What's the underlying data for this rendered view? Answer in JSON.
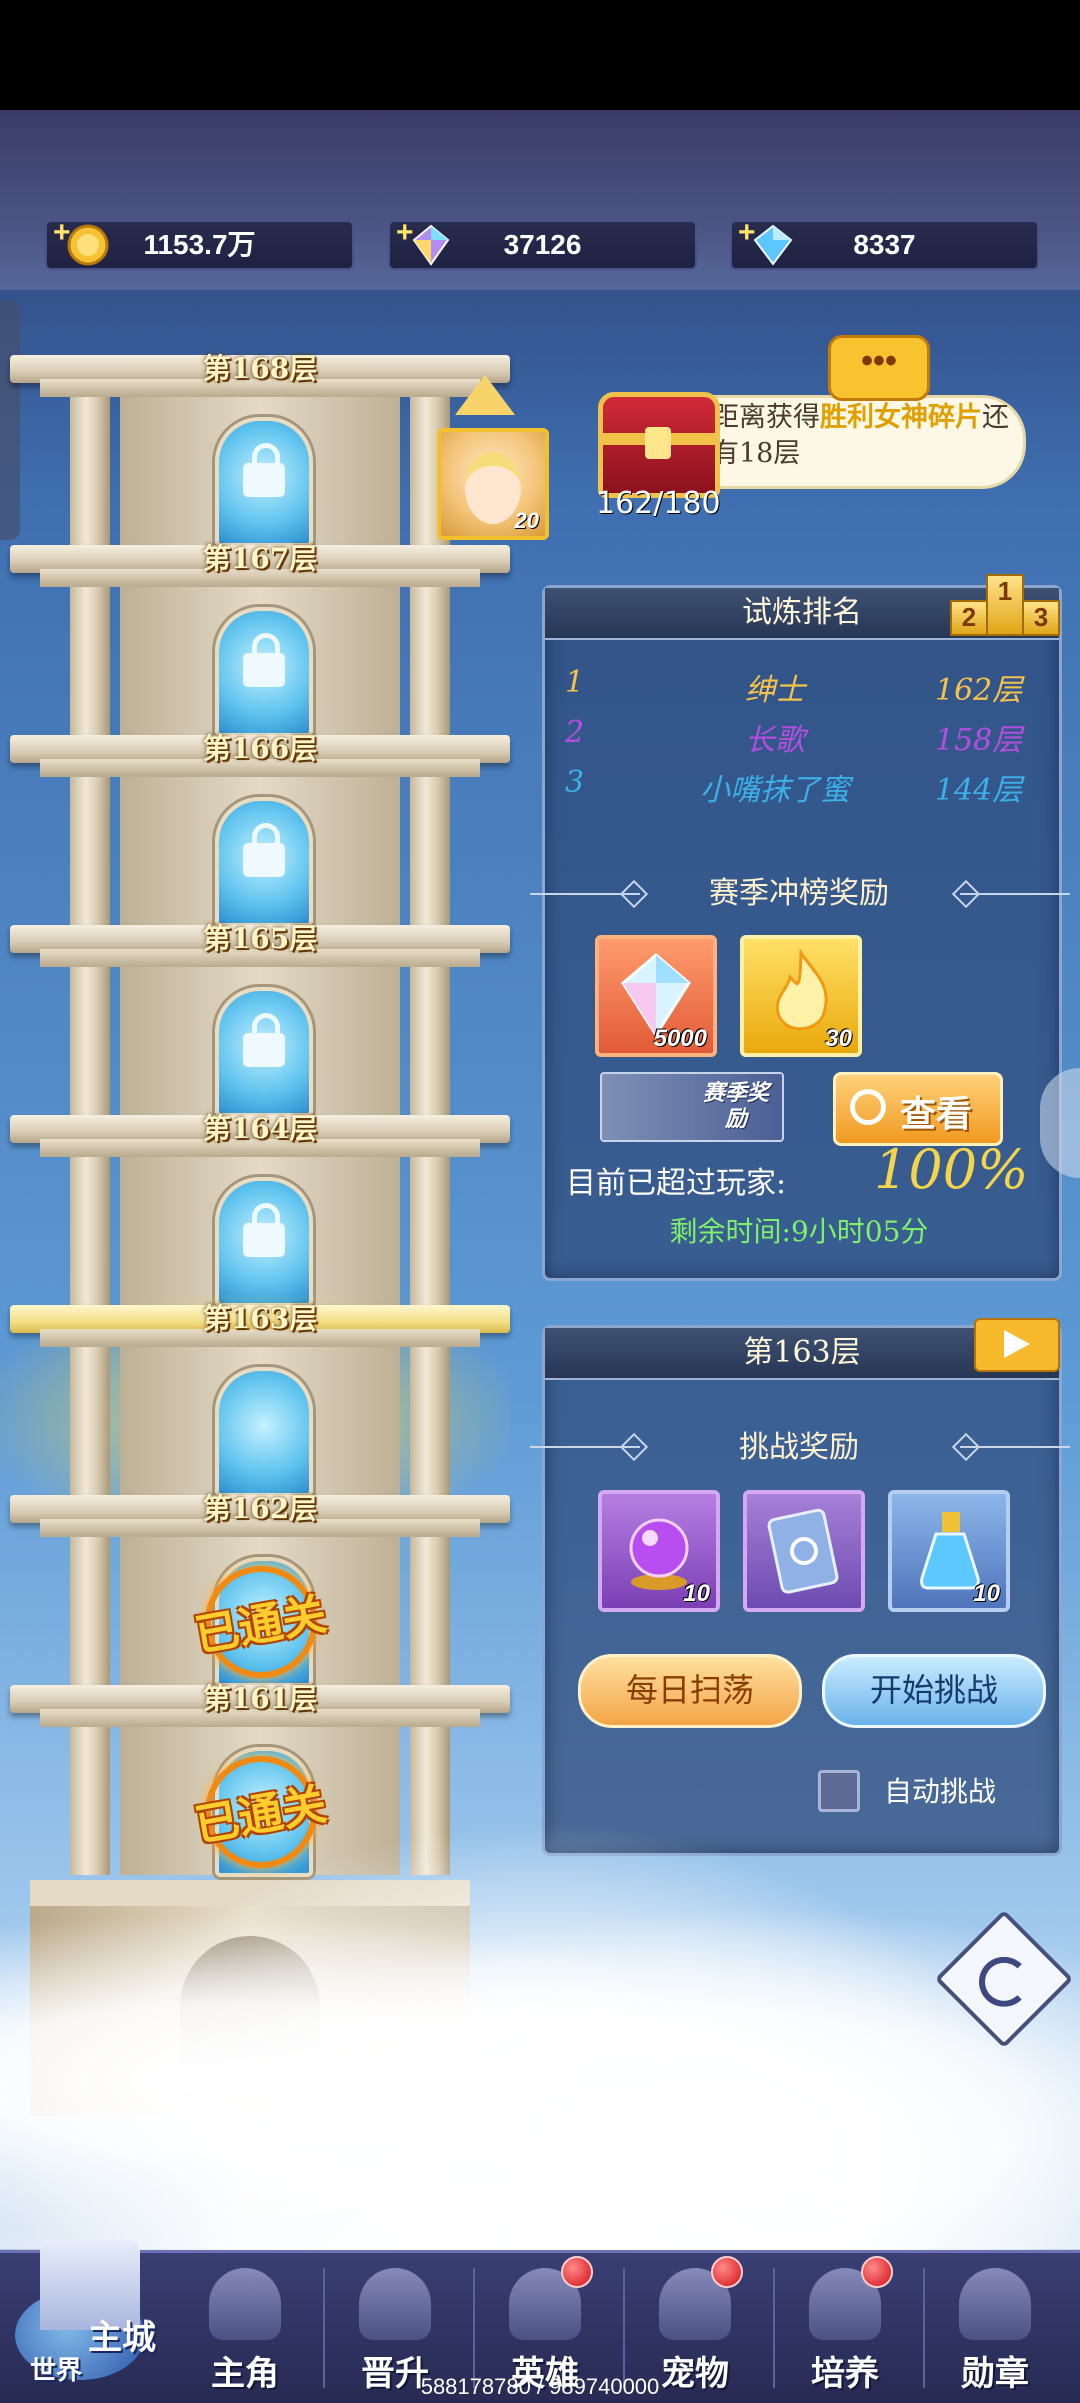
{
  "resources": [
    {
      "icon": "gold-coin-icon",
      "value": "1153.7万"
    },
    {
      "icon": "rainbow-gem-icon",
      "value": "37126"
    },
    {
      "icon": "blue-diamond-icon",
      "value": "8337"
    }
  ],
  "tower": {
    "floors": [
      {
        "label": "第168层",
        "state": "locked"
      },
      {
        "label": "第167层",
        "state": "locked"
      },
      {
        "label": "第166层",
        "state": "locked"
      },
      {
        "label": "第165层",
        "state": "locked"
      },
      {
        "label": "第164层",
        "state": "locked"
      },
      {
        "label": "第163层",
        "state": "current"
      },
      {
        "label": "第162层",
        "state": "cleared"
      },
      {
        "label": "第161层",
        "state": "cleared"
      }
    ],
    "cleared_text": "已通关",
    "hero_level": "20"
  },
  "chest": {
    "text_prefix": "距离获得",
    "text_highlight": "胜利女神碎片",
    "text_suffix": "还有18层",
    "progress": "162/180",
    "chat_glyph": "•••"
  },
  "ranking": {
    "title": "试炼排名",
    "podium": [
      "2",
      "1",
      "3"
    ],
    "rows": [
      {
        "rank": "1",
        "name": "绅士",
        "floor": "162层"
      },
      {
        "rank": "2",
        "name": "长歌",
        "floor": "158层"
      },
      {
        "rank": "3",
        "name": "小嘴抹了蜜",
        "floor": "144层"
      }
    ],
    "season_title": "赛季冲榜奖励",
    "season_rewards": [
      {
        "icon": "crystal-icon",
        "qty": "5000"
      },
      {
        "icon": "fire-essence-icon",
        "qty": "30"
      }
    ],
    "season_banner_label": "赛季奖励",
    "view_button": "查看",
    "surpass_label": "目前已超过玩家:",
    "surpass_percent": "100%",
    "remaining_time": "剩余时间:9小时05分"
  },
  "challenge": {
    "title": "第163层",
    "rewards_title": "挑战奖励",
    "rewards": [
      {
        "icon": "purple-orb-icon",
        "qty": "10"
      },
      {
        "icon": "card-icon",
        "qty": ""
      },
      {
        "icon": "potion-icon",
        "qty": "10"
      }
    ],
    "sweep_button": "每日扫荡",
    "start_button": "开始挑战",
    "auto_label": "自动挑战"
  },
  "nav": {
    "world_label_1": "主城",
    "world_label_2": "世界",
    "items": [
      {
        "label": "主角",
        "badge": false
      },
      {
        "label": "晋升",
        "badge": false
      },
      {
        "label": "英雄",
        "badge": true
      },
      {
        "label": "宠物",
        "badge": true
      },
      {
        "label": "培养",
        "badge": true
      },
      {
        "label": "勋章",
        "badge": false
      }
    ]
  },
  "footer": "588178780 / 989740000"
}
